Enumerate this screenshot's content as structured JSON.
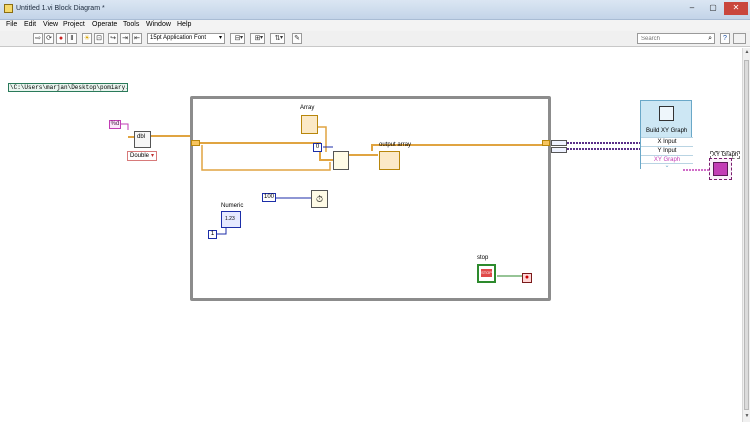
{
  "window": {
    "title": "Untitled 1.vi Block Diagram *",
    "controls": [
      "–",
      "▢",
      "✕"
    ]
  },
  "menu": [
    "File",
    "Edit",
    "View",
    "Project",
    "Operate",
    "Tools",
    "Window",
    "Help"
  ],
  "toolbar": {
    "buttons": [
      {
        "name": "run-arrow-icon",
        "glyph": "⇨"
      },
      {
        "name": "run-continuously-icon",
        "glyph": "⟳"
      },
      {
        "name": "abort-icon",
        "glyph": "●"
      },
      {
        "name": "pause-icon",
        "glyph": "Ⅱ"
      },
      {
        "name": "highlight-execution-icon",
        "glyph": "☀"
      },
      {
        "name": "retain-wire-values-icon",
        "glyph": "⊡"
      },
      {
        "name": "step-into-icon",
        "glyph": "↪"
      },
      {
        "name": "step-over-icon",
        "glyph": "⇥"
      },
      {
        "name": "step-out-icon",
        "glyph": "⇤"
      }
    ],
    "font_select": "15pt Application Font",
    "align_buttons": [
      {
        "name": "align-objects-icon",
        "glyph": "⊟"
      },
      {
        "name": "distribute-objects-icon",
        "glyph": "⊞"
      },
      {
        "name": "reorder-icon",
        "glyph": "⇅"
      }
    ],
    "cleanup_icon": "✎",
    "search": {
      "placeholder": "Search",
      "value": "Search"
    },
    "help_icon": "?"
  },
  "diagram": {
    "path_constant": "\\C:\\Users\\marjan\\Desktop\\pomiary.txt",
    "format_string": "%d",
    "delimiter_const": "\\t",
    "read_node_label": "dbl",
    "type_ring": "Double",
    "array_label": "Array",
    "index_const": "0",
    "output_array_label": "output array",
    "wait_const": "100",
    "numeric_label": "Numeric",
    "numeric_const": "1",
    "numeric_display": "1.23",
    "stop_label": "stop",
    "stop_text": "STOP",
    "build_xy": {
      "title": "Build XY Graph",
      "inputs": [
        "X Input",
        "Y Input",
        "XY Graph"
      ]
    },
    "xy_graph_label": "XY Graph"
  },
  "colors": {
    "orange_wire": "#e0a441",
    "blue_wire": "#1c2ea8",
    "pink_wire": "#c23db5",
    "loop_border": "#8c8c8c"
  }
}
